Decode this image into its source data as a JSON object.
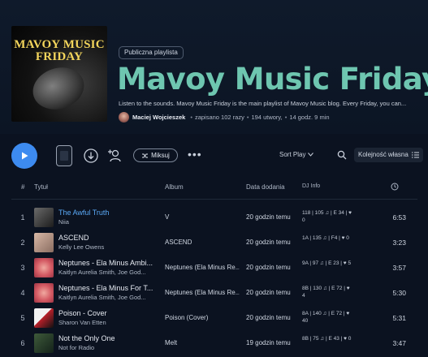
{
  "header": {
    "cover_text": "MAVOY MUSIC FRIDAY",
    "badge": "Publiczna playlista",
    "title": "Mavoy Music Friday",
    "description": "Listen to the sounds. Mavoy Music Friday is the main playlist of Mavoy Music blog. Every Friday, you can...",
    "owner": "Maciej Wojcieszek",
    "saves": "zapisano 102 razy",
    "tracks": "194 utwory,",
    "duration": "14 godz. 9 min"
  },
  "toolbar": {
    "mix_label": "Miksuj",
    "more_label": "•••",
    "sort_label": "Sort Play",
    "order_label": "Kolejność własna"
  },
  "columns": {
    "hash": "#",
    "title": "Tytuł",
    "album": "Album",
    "date": "Data dodania",
    "djinfo": "DJ Info"
  },
  "tracks": [
    {
      "num": "1",
      "title": "The Awful Truth",
      "artist": "Niia",
      "album": "V",
      "date": "20 godzin temu",
      "dj": "118 | 105 ♫ | E 34 | ♥ 0",
      "duration": "6:53",
      "active": true
    },
    {
      "num": "2",
      "title": "ASCEND",
      "artist": "Kelly Lee Owens",
      "album": "ASCEND",
      "date": "20 godzin temu",
      "dj": "1A | 135 ♫ | F4 | ♥ 0",
      "duration": "3:23",
      "active": false
    },
    {
      "num": "3",
      "title": "Neptunes - Ela Minus Ambi...",
      "artist": "Kaitlyn Aurelia Smith, Joe God...",
      "album": "Neptunes (Ela Minus Re...",
      "date": "20 godzin temu",
      "dj": "9A | 97 ♫ | E 23 | ♥ 5",
      "duration": "3:57",
      "active": false
    },
    {
      "num": "4",
      "title": "Neptunes - Ela Minus For T...",
      "artist": "Kaitlyn Aurelia Smith, Joe God...",
      "album": "Neptunes (Ela Minus Re...",
      "date": "20 godzin temu",
      "dj": "8B | 130 ♫ | E 72 | ♥ 4",
      "duration": "5:30",
      "active": false
    },
    {
      "num": "5",
      "title": "Poison - Cover",
      "artist": "Sharon Van Etten",
      "album": "Poison (Cover)",
      "date": "20 godzin temu",
      "dj": "8A | 140 ♫ | E 72 | ♥ 40",
      "duration": "5:31",
      "active": false
    },
    {
      "num": "6",
      "title": "Not the Only One",
      "artist": "Not for Radio",
      "album": "Melt",
      "date": "19 godzin temu",
      "dj": "8B | 75 ♫ | E 43 | ♥ 0",
      "duration": "3:47",
      "active": false
    }
  ],
  "colors": {
    "accent_title": "#6ec6b0",
    "play_button": "#3d8bf0",
    "active_track": "#5aa9f6",
    "background": "#0b1220"
  },
  "icons": [
    "play-icon",
    "download-icon",
    "add-user-icon",
    "shuffle-icon",
    "search-icon",
    "list-icon",
    "clock-icon"
  ]
}
